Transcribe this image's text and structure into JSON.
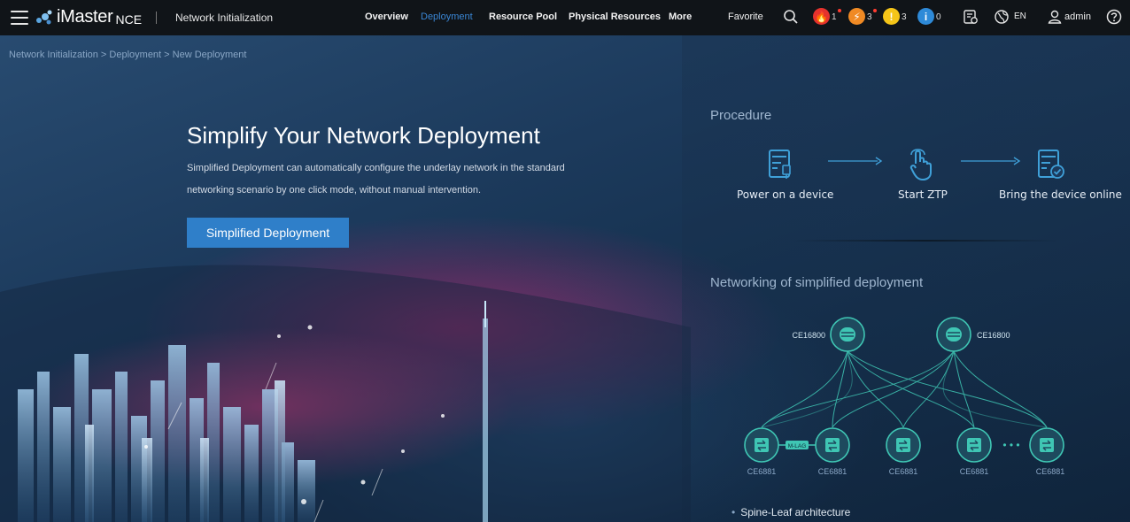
{
  "header": {
    "brand": "iMaster",
    "brand_suffix": "NCE",
    "app_title": "Network Initialization",
    "nav": [
      {
        "label": "Overview",
        "active": false
      },
      {
        "label": "Deployment",
        "active": true
      },
      {
        "label": "Resource Pool",
        "active": false
      },
      {
        "label": "Physical Resources",
        "active": false
      },
      {
        "label": "More",
        "active": false
      }
    ],
    "favorite": "Favorite",
    "alarms": [
      {
        "name": "critical",
        "glyph": "🔥",
        "count": "1",
        "color": "#e5322d"
      },
      {
        "name": "major",
        "glyph": "⚡",
        "count": "3",
        "color": "#f08a24"
      },
      {
        "name": "minor",
        "glyph": "!",
        "count": "3",
        "color": "#f5c518"
      },
      {
        "name": "warning",
        "glyph": "i",
        "count": "0",
        "color": "#2e8ad8"
      }
    ],
    "language": "EN",
    "user": "admin"
  },
  "breadcrumb": "Network Initialization > Deployment > New Deployment",
  "hero": {
    "title": "Simplify Your Network Deployment",
    "description": "Simplified Deployment can automatically configure the underlay network in the standard networking scenario by one click mode, without manual intervention.",
    "button": "Simplified Deployment"
  },
  "procedure": {
    "title": "Procedure",
    "steps": [
      "Power on a device",
      "Start ZTP",
      "Bring the device online"
    ]
  },
  "networking": {
    "title": "Networking of simplified deployment",
    "spines": [
      "CE16800",
      "CE16800"
    ],
    "leaves": [
      "CE6881",
      "CE6881",
      "CE6881",
      "CE6881",
      "CE6881"
    ],
    "mlag": "M-LAG",
    "ellipsis": "• • •",
    "bullet": "Spine-Leaf architecture"
  },
  "colors": {
    "accent": "#2f7fc9",
    "active_nav": "#3a86d4",
    "topology": "#3fc6b4"
  }
}
